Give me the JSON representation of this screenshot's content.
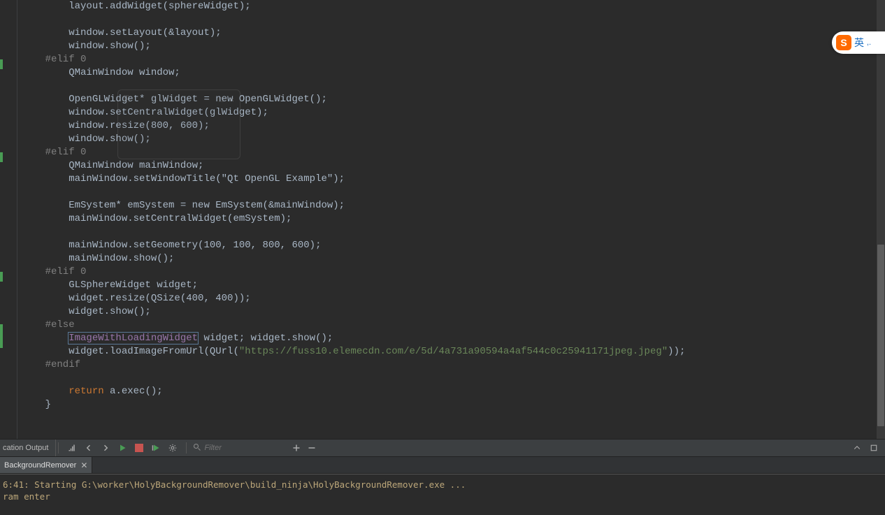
{
  "code": {
    "l01": "        layout.addWidget(sphereWidget);",
    "l02": "",
    "l03": "        window.setLayout(&layout);",
    "l04": "        window.show();",
    "l05": "    #elif 0",
    "l06": "        QMainWindow window;",
    "l07": "",
    "l08": "        OpenGLWidget* glWidget = new OpenGLWidget();",
    "l09": "        window.setCentralWidget(glWidget);",
    "l10": "        window.resize(800, 600);",
    "l11": "        window.show();",
    "l12": "    #elif 0",
    "l13": "        QMainWindow mainWindow;",
    "l14": "        mainWindow.setWindowTitle(\"Qt OpenGL Example\");",
    "l15": "",
    "l16": "        EmSystem* emSystem = new EmSystem(&mainWindow);",
    "l17": "        mainWindow.setCentralWidget(emSystem);",
    "l18": "",
    "l19": "        mainWindow.setGeometry(100, 100, 800, 600);",
    "l20": "        mainWindow.show();",
    "l21": "    #elif 0",
    "l22": "        GLSphereWidget widget;",
    "l23": "        widget.resize(QSize(400, 400));",
    "l24": "        widget.show();",
    "l25": "    #else",
    "l26a": "        ",
    "l26b": "ImageWithLoadingWidget",
    "l26c": " widget; widget.show();",
    "l27a": "        widget.loadImageFromUrl(",
    "l27b": "QUrl",
    "l27c": "(",
    "l27d": "\"https://fuss10.elemecdn.com/e/5d/4a731a90594a4af544c0c25941171jpeg.jpeg\"",
    "l27e": "));",
    "l28": "    #endif",
    "l29": "",
    "l30a": "        ",
    "l30b": "return",
    "l30c": " a.exec();",
    "l31": "    }"
  },
  "panel": {
    "title": "cation Output",
    "filter_placeholder": "Filter"
  },
  "tab": {
    "label": "BackgroundRemover"
  },
  "output": {
    "l1": "6:41: Starting G:\\worker\\HolyBackgroundRemover\\build_ninja\\HolyBackgroundRemover.exe ...",
    "l2": "ram enter"
  },
  "ime": {
    "logo": "S",
    "lang": "英",
    "extra": ",."
  }
}
